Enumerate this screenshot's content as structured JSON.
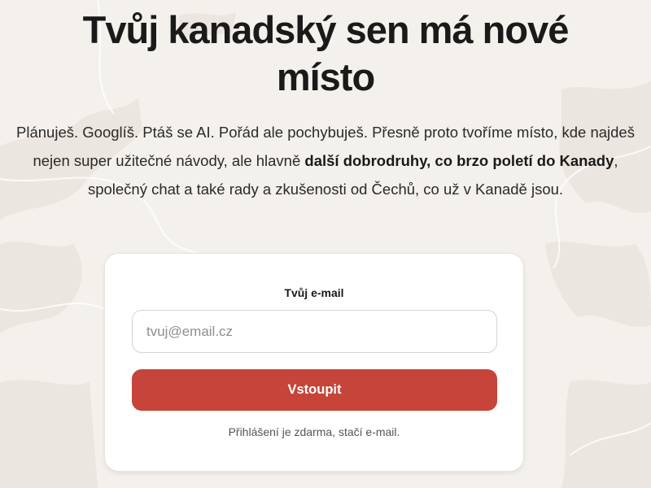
{
  "hero": {
    "headline": "Tvůj kanadský sen má nové místo",
    "lead_part1": "Plánuješ. Googlíš. Ptáš se AI. Pořád ale pochybuješ. Přesně proto tvoříme místo, kde najdeš nejen super užitečné návody, ale hlavně ",
    "lead_bold": "další dobrodruhy, co brzo poletí do Kanady",
    "lead_part2": ", společný chat a také rady a zkušenosti od Čechů, co už v Kanadě jsou."
  },
  "signup": {
    "email_label": "Tvůj e-mail",
    "email_placeholder": "tvuj@email.cz",
    "email_value": "",
    "submit_label": "Vstoupit",
    "note": "Přihlášení je zdarma, stačí e-mail."
  },
  "colors": {
    "background": "#f4f1ec",
    "accent": "#c6443a",
    "map_shape": "#ebe6df"
  }
}
